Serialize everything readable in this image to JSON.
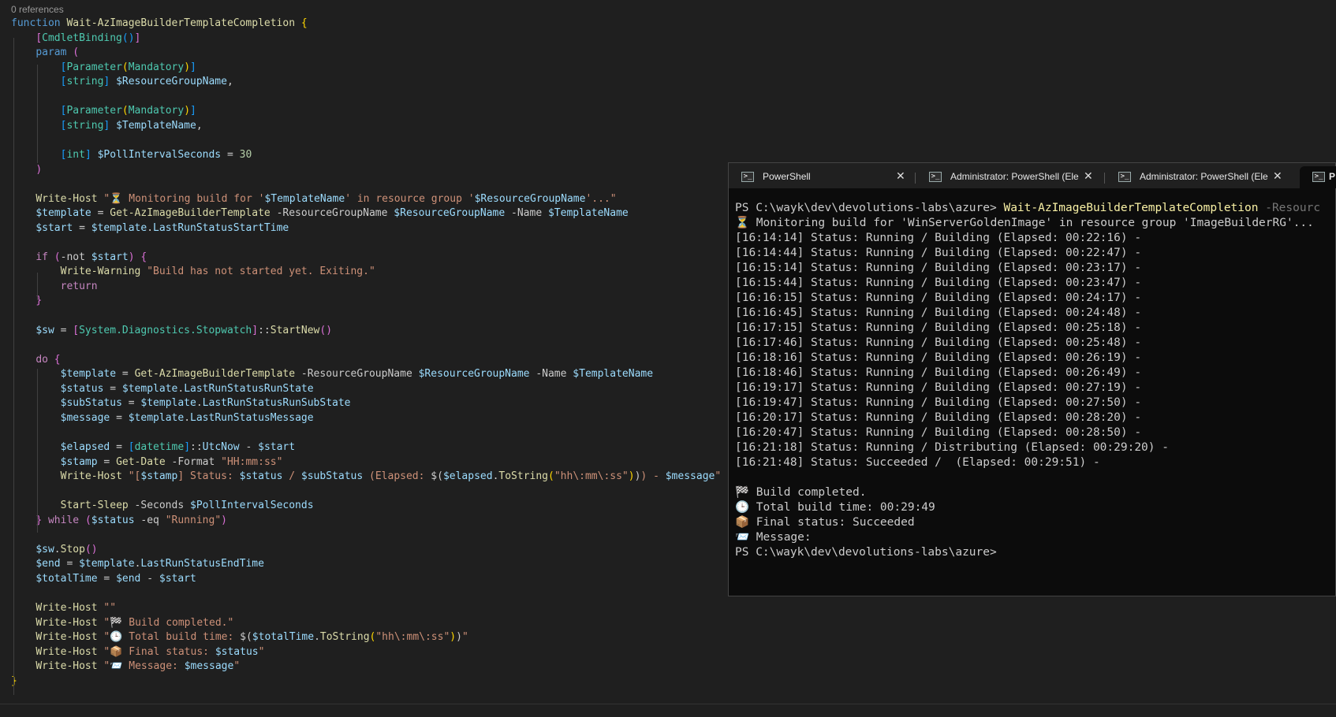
{
  "editor": {
    "code_lens": "0 references",
    "lines": [
      [
        [
          "t-kw",
          "function "
        ],
        [
          "t-fn",
          "Wait-AzImageBuilderTemplateCompletion "
        ],
        [
          "t-br1",
          "{"
        ]
      ],
      [
        [
          "t-pl",
          "    "
        ],
        [
          "t-br2",
          "["
        ],
        [
          "t-ty",
          "CmdletBinding"
        ],
        [
          "t-br3",
          "()"
        ],
        [
          "t-br2",
          "]"
        ]
      ],
      [
        [
          "t-pl",
          "    "
        ],
        [
          "t-kw",
          "param "
        ],
        [
          "t-br2",
          "("
        ]
      ],
      [
        [
          "t-pl",
          "        "
        ],
        [
          "t-br3",
          "["
        ],
        [
          "t-ty",
          "Parameter"
        ],
        [
          "t-br1",
          "("
        ],
        [
          "t-ty",
          "Mandatory"
        ],
        [
          "t-br1",
          ")"
        ],
        [
          "t-br3",
          "]"
        ]
      ],
      [
        [
          "t-pl",
          "        "
        ],
        [
          "t-br3",
          "["
        ],
        [
          "t-ty",
          "string"
        ],
        [
          "t-br3",
          "]"
        ],
        [
          "t-pl",
          " "
        ],
        [
          "t-var",
          "$ResourceGroupName"
        ],
        [
          "t-pl",
          ","
        ]
      ],
      [],
      [
        [
          "t-pl",
          "        "
        ],
        [
          "t-br3",
          "["
        ],
        [
          "t-ty",
          "Parameter"
        ],
        [
          "t-br1",
          "("
        ],
        [
          "t-ty",
          "Mandatory"
        ],
        [
          "t-br1",
          ")"
        ],
        [
          "t-br3",
          "]"
        ]
      ],
      [
        [
          "t-pl",
          "        "
        ],
        [
          "t-br3",
          "["
        ],
        [
          "t-ty",
          "string"
        ],
        [
          "t-br3",
          "]"
        ],
        [
          "t-pl",
          " "
        ],
        [
          "t-var",
          "$TemplateName"
        ],
        [
          "t-pl",
          ","
        ]
      ],
      [],
      [
        [
          "t-pl",
          "        "
        ],
        [
          "t-br3",
          "["
        ],
        [
          "t-ty",
          "int"
        ],
        [
          "t-br3",
          "]"
        ],
        [
          "t-pl",
          " "
        ],
        [
          "t-var",
          "$PollIntervalSeconds"
        ],
        [
          "t-pl",
          " = "
        ],
        [
          "t-num",
          "30"
        ]
      ],
      [
        [
          "t-pl",
          "    "
        ],
        [
          "t-br2",
          ")"
        ]
      ],
      [],
      [
        [
          "t-pl",
          "    "
        ],
        [
          "t-fn",
          "Write-Host "
        ],
        [
          "t-str",
          "\"⏳ Monitoring build for '"
        ],
        [
          "t-var",
          "$TemplateName"
        ],
        [
          "t-str",
          "' in resource group '"
        ],
        [
          "t-var",
          "$ResourceGroupName"
        ],
        [
          "t-str",
          "'...\""
        ]
      ],
      [
        [
          "t-pl",
          "    "
        ],
        [
          "t-var",
          "$template"
        ],
        [
          "t-pl",
          " = "
        ],
        [
          "t-fn",
          "Get-AzImageBuilderTemplate "
        ],
        [
          "t-pl",
          "-ResourceGroupName "
        ],
        [
          "t-var",
          "$ResourceGroupName"
        ],
        [
          "t-pl",
          " -Name "
        ],
        [
          "t-var",
          "$TemplateName"
        ]
      ],
      [
        [
          "t-pl",
          "    "
        ],
        [
          "t-var",
          "$start"
        ],
        [
          "t-pl",
          " = "
        ],
        [
          "t-var",
          "$template"
        ],
        [
          "t-pl",
          "."
        ],
        [
          "t-var",
          "LastRunStatusStartTime"
        ]
      ],
      [],
      [
        [
          "t-pl",
          "    "
        ],
        [
          "t-ctl",
          "if "
        ],
        [
          "t-br2",
          "("
        ],
        [
          "t-pl",
          "-not "
        ],
        [
          "t-var",
          "$start"
        ],
        [
          "t-br2",
          ")"
        ],
        [
          "t-pl",
          " "
        ],
        [
          "t-br2",
          "{"
        ]
      ],
      [
        [
          "t-pl",
          "        "
        ],
        [
          "t-fn",
          "Write-Warning "
        ],
        [
          "t-str",
          "\"Build has not started yet. Exiting.\""
        ]
      ],
      [
        [
          "t-pl",
          "        "
        ],
        [
          "t-ctl",
          "return"
        ]
      ],
      [
        [
          "t-pl",
          "    "
        ],
        [
          "t-br2",
          "}"
        ]
      ],
      [],
      [
        [
          "t-pl",
          "    "
        ],
        [
          "t-var",
          "$sw"
        ],
        [
          "t-pl",
          " = "
        ],
        [
          "t-br2",
          "["
        ],
        [
          "t-ty",
          "System.Diagnostics.Stopwatch"
        ],
        [
          "t-br2",
          "]"
        ],
        [
          "t-pl",
          "::"
        ],
        [
          "t-fn",
          "StartNew"
        ],
        [
          "t-br2",
          "()"
        ]
      ],
      [],
      [
        [
          "t-pl",
          "    "
        ],
        [
          "t-ctl",
          "do "
        ],
        [
          "t-br2",
          "{"
        ]
      ],
      [
        [
          "t-pl",
          "        "
        ],
        [
          "t-var",
          "$template"
        ],
        [
          "t-pl",
          " = "
        ],
        [
          "t-fn",
          "Get-AzImageBuilderTemplate "
        ],
        [
          "t-pl",
          "-ResourceGroupName "
        ],
        [
          "t-var",
          "$ResourceGroupName"
        ],
        [
          "t-pl",
          " -Name "
        ],
        [
          "t-var",
          "$TemplateName"
        ]
      ],
      [
        [
          "t-pl",
          "        "
        ],
        [
          "t-var",
          "$status"
        ],
        [
          "t-pl",
          " = "
        ],
        [
          "t-var",
          "$template"
        ],
        [
          "t-pl",
          "."
        ],
        [
          "t-var",
          "LastRunStatusRunState"
        ]
      ],
      [
        [
          "t-pl",
          "        "
        ],
        [
          "t-var",
          "$subStatus"
        ],
        [
          "t-pl",
          " = "
        ],
        [
          "t-var",
          "$template"
        ],
        [
          "t-pl",
          "."
        ],
        [
          "t-var",
          "LastRunStatusRunSubState"
        ]
      ],
      [
        [
          "t-pl",
          "        "
        ],
        [
          "t-var",
          "$message"
        ],
        [
          "t-pl",
          " = "
        ],
        [
          "t-var",
          "$template"
        ],
        [
          "t-pl",
          "."
        ],
        [
          "t-var",
          "LastRunStatusMessage"
        ]
      ],
      [],
      [
        [
          "t-pl",
          "        "
        ],
        [
          "t-var",
          "$elapsed"
        ],
        [
          "t-pl",
          " = "
        ],
        [
          "t-br3",
          "["
        ],
        [
          "t-ty",
          "datetime"
        ],
        [
          "t-br3",
          "]"
        ],
        [
          "t-pl",
          "::"
        ],
        [
          "t-var",
          "UtcNow"
        ],
        [
          "t-pl",
          " - "
        ],
        [
          "t-var",
          "$start"
        ]
      ],
      [
        [
          "t-pl",
          "        "
        ],
        [
          "t-var",
          "$stamp"
        ],
        [
          "t-pl",
          " = "
        ],
        [
          "t-fn",
          "Get-Date "
        ],
        [
          "t-pl",
          "-Format "
        ],
        [
          "t-str",
          "\"HH:mm:ss\""
        ]
      ],
      [
        [
          "t-pl",
          "        "
        ],
        [
          "t-fn",
          "Write-Host "
        ],
        [
          "t-str",
          "\"["
        ],
        [
          "t-var",
          "$stamp"
        ],
        [
          "t-str",
          "] Status: "
        ],
        [
          "t-var",
          "$status"
        ],
        [
          "t-str",
          " / "
        ],
        [
          "t-var",
          "$subStatus"
        ],
        [
          "t-str",
          " (Elapsed: "
        ],
        [
          "t-pl",
          "$("
        ],
        [
          "t-var",
          "$elapsed"
        ],
        [
          "t-pl",
          "."
        ],
        [
          "t-fn",
          "ToString"
        ],
        [
          "t-br1",
          "("
        ],
        [
          "t-str",
          "\"hh\\:mm\\:ss\""
        ],
        [
          "t-br1",
          ")"
        ],
        [
          "t-pl",
          ")"
        ],
        [
          "t-str",
          ") - "
        ],
        [
          "t-var",
          "$message"
        ],
        [
          "t-str",
          "\""
        ]
      ],
      [],
      [
        [
          "t-pl",
          "        "
        ],
        [
          "t-fn",
          "Start-Sleep "
        ],
        [
          "t-pl",
          "-Seconds "
        ],
        [
          "t-var",
          "$PollIntervalSeconds"
        ]
      ],
      [
        [
          "t-pl",
          "    "
        ],
        [
          "t-br2",
          "}"
        ],
        [
          "t-ctl",
          " while "
        ],
        [
          "t-br2",
          "("
        ],
        [
          "t-var",
          "$status"
        ],
        [
          "t-pl",
          " -eq "
        ],
        [
          "t-str",
          "\"Running\""
        ],
        [
          "t-br2",
          ")"
        ]
      ],
      [],
      [
        [
          "t-pl",
          "    "
        ],
        [
          "t-var",
          "$sw"
        ],
        [
          "t-pl",
          "."
        ],
        [
          "t-fn",
          "Stop"
        ],
        [
          "t-br2",
          "()"
        ]
      ],
      [
        [
          "t-pl",
          "    "
        ],
        [
          "t-var",
          "$end"
        ],
        [
          "t-pl",
          " = "
        ],
        [
          "t-var",
          "$template"
        ],
        [
          "t-pl",
          "."
        ],
        [
          "t-var",
          "LastRunStatusEndTime"
        ]
      ],
      [
        [
          "t-pl",
          "    "
        ],
        [
          "t-var",
          "$totalTime"
        ],
        [
          "t-pl",
          " = "
        ],
        [
          "t-var",
          "$end"
        ],
        [
          "t-pl",
          " - "
        ],
        [
          "t-var",
          "$start"
        ]
      ],
      [],
      [
        [
          "t-pl",
          "    "
        ],
        [
          "t-fn",
          "Write-Host "
        ],
        [
          "t-str",
          "\"\""
        ]
      ],
      [
        [
          "t-pl",
          "    "
        ],
        [
          "t-fn",
          "Write-Host "
        ],
        [
          "t-str",
          "\"🏁 Build completed.\""
        ]
      ],
      [
        [
          "t-pl",
          "    "
        ],
        [
          "t-fn",
          "Write-Host "
        ],
        [
          "t-str",
          "\"🕒 Total build time: "
        ],
        [
          "t-pl",
          "$("
        ],
        [
          "t-var",
          "$totalTime"
        ],
        [
          "t-pl",
          "."
        ],
        [
          "t-fn",
          "ToString"
        ],
        [
          "t-br1",
          "("
        ],
        [
          "t-str",
          "\"hh\\:mm\\:ss\""
        ],
        [
          "t-br1",
          ")"
        ],
        [
          "t-pl",
          ")"
        ],
        [
          "t-str",
          "\""
        ]
      ],
      [
        [
          "t-pl",
          "    "
        ],
        [
          "t-fn",
          "Write-Host "
        ],
        [
          "t-str",
          "\"📦 Final status: "
        ],
        [
          "t-var",
          "$status"
        ],
        [
          "t-str",
          "\""
        ]
      ],
      [
        [
          "t-pl",
          "    "
        ],
        [
          "t-fn",
          "Write-Host "
        ],
        [
          "t-str",
          "\"📨 Message: "
        ],
        [
          "t-var",
          "$message"
        ],
        [
          "t-str",
          "\""
        ]
      ],
      [
        [
          "t-br1",
          "}"
        ]
      ]
    ]
  },
  "terminal": {
    "tabs": [
      {
        "icon": "powershell-icon",
        "label": "PowerShell",
        "close": "✕"
      },
      {
        "icon": "powershell-icon",
        "label": "Administrator: PowerShell (Ele",
        "close": "✕"
      },
      {
        "icon": "powershell-icon",
        "label": "Administrator: PowerShell (Ele",
        "close": "✕"
      },
      {
        "icon": "powershell-icon",
        "label": "P",
        "close": ""
      }
    ],
    "prompt": "PS C:\\wayk\\dev\\devolutions-labs\\azure> ",
    "command": "Wait-AzImageBuilderTemplateCompletion",
    "command_param": " -Resourc",
    "output": [
      "⏳ Monitoring build for 'WinServerGoldenImage' in resource group 'ImageBuilderRG'...",
      "[16:14:14] Status: Running / Building (Elapsed: 00:22:16) -",
      "[16:14:44] Status: Running / Building (Elapsed: 00:22:47) -",
      "[16:15:14] Status: Running / Building (Elapsed: 00:23:17) -",
      "[16:15:44] Status: Running / Building (Elapsed: 00:23:47) -",
      "[16:16:15] Status: Running / Building (Elapsed: 00:24:17) -",
      "[16:16:45] Status: Running / Building (Elapsed: 00:24:48) -",
      "[16:17:15] Status: Running / Building (Elapsed: 00:25:18) -",
      "[16:17:46] Status: Running / Building (Elapsed: 00:25:48) -",
      "[16:18:16] Status: Running / Building (Elapsed: 00:26:19) -",
      "[16:18:46] Status: Running / Building (Elapsed: 00:26:49) -",
      "[16:19:17] Status: Running / Building (Elapsed: 00:27:19) -",
      "[16:19:47] Status: Running / Building (Elapsed: 00:27:50) -",
      "[16:20:17] Status: Running / Building (Elapsed: 00:28:20) -",
      "[16:20:47] Status: Running / Building (Elapsed: 00:28:50) -",
      "[16:21:18] Status: Running / Distributing (Elapsed: 00:29:20) -",
      "[16:21:48] Status: Succeeded /  (Elapsed: 00:29:51) -",
      "",
      "🏁 Build completed.",
      "🕒 Total build time: 00:29:49",
      "📦 Final status: Succeeded",
      "📨 Message:"
    ],
    "final_prompt": "PS C:\\wayk\\dev\\devolutions-labs\\azure>"
  }
}
